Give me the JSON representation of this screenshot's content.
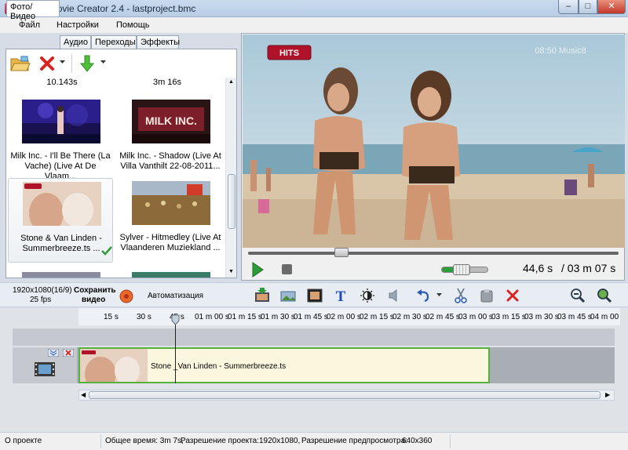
{
  "window": {
    "title": "Bolide Movie Creator 2.4 - lastproject.bmc"
  },
  "menu": [
    "Файл",
    "Настройки",
    "Помощь"
  ],
  "tabs": [
    "Фото/Видео",
    "Аудио",
    "Переходы",
    "Эффекты"
  ],
  "media": {
    "durations": [
      "10.143s",
      "3m 16s"
    ],
    "items": [
      {
        "label": "Milk Inc.  - I'll Be There (La\nVache) (Live At De Vlaam...",
        "selected": false
      },
      {
        "label": "Milk Inc. - Shadow (Live At\nVilla Vanthilt 22-08-2011...",
        "selected": false
      },
      {
        "label": "Stone & Van Linden -\nSummerbreeze.ts ...",
        "selected": true
      },
      {
        "label": "Sylver - Hitmedley (Live At\nVlaanderen Muziekland ...",
        "selected": false
      }
    ]
  },
  "player": {
    "overlay_badge": "HITS",
    "channel_logo": "08:50 Music8",
    "position_fraction": 0.25,
    "current_time": "44,6 s",
    "total_time": "/ 03 m 07 s"
  },
  "bottom": {
    "resolution": "1920x1080(16/9)",
    "fps": "25 fps",
    "save_line1": "Сохранить",
    "save_line2": "видео",
    "automation": "Автоматизация"
  },
  "timeline": {
    "ticks": [
      "15 s",
      "30 s",
      "45 s",
      "01 m 00 s",
      "01 m 15 s",
      "01 m 30 s",
      "01 m 45 s",
      "02 m 00 s",
      "02 m 15 s",
      "02 m 30 s",
      "02 m 45 s",
      "03 m 00 s",
      "03 m 15 s",
      "03 m 30 s",
      "03 m 45 s",
      "04 m 00"
    ],
    "clip_label": "Stone _Van Linden - Summerbreeze.ts"
  },
  "status": {
    "about": "О проекте",
    "total_time": "Общее время: 3m 7s,",
    "project_res_label": "Разрешение проекта:",
    "project_res": "1920x1080,",
    "preview_res_label": "Разрешение предпросмотра:",
    "preview_res": "640x360"
  },
  "colors": {
    "accent_play": "#2e9c3a",
    "clip_border": "#56b23c",
    "badge": "#b0122a"
  }
}
